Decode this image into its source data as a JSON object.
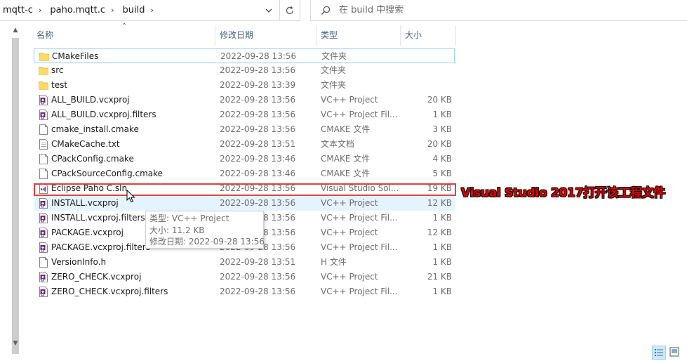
{
  "address": {
    "crumbs": [
      "mqtt-c",
      "paho.mqtt.c",
      "build"
    ],
    "separator": "›"
  },
  "search": {
    "placeholder": "在 build 中搜索"
  },
  "columns": {
    "name": "名称",
    "date": "修改日期",
    "type": "类型",
    "size": "大小"
  },
  "files": [
    {
      "name": "CMakeFiles",
      "date": "2022-09-28 13:56",
      "type": "文件夹",
      "size": "",
      "icon": "folder-icon"
    },
    {
      "name": "src",
      "date": "2022-09-28 13:56",
      "type": "文件夹",
      "size": "",
      "icon": "folder-icon"
    },
    {
      "name": "test",
      "date": "2022-09-28 13:39",
      "type": "文件夹",
      "size": "",
      "icon": "folder-icon"
    },
    {
      "name": "ALL_BUILD.vcxproj",
      "date": "2022-09-28 13:56",
      "type": "VC++ Project",
      "size": "20 KB",
      "icon": "vcxproj-icon"
    },
    {
      "name": "ALL_BUILD.vcxproj.filters",
      "date": "2022-09-28 13:56",
      "type": "VC++ Project Fil...",
      "size": "1 KB",
      "icon": "vcxproj-icon"
    },
    {
      "name": "cmake_install.cmake",
      "date": "2022-09-28 13:56",
      "type": "CMAKE 文件",
      "size": "3 KB",
      "icon": "document-icon"
    },
    {
      "name": "CMakeCache.txt",
      "date": "2022-09-28 13:51",
      "type": "文本文档",
      "size": "20 KB",
      "icon": "text-file-icon"
    },
    {
      "name": "CPackConfig.cmake",
      "date": "2022-09-28 13:46",
      "type": "CMAKE 文件",
      "size": "4 KB",
      "icon": "document-icon"
    },
    {
      "name": "CPackSourceConfig.cmake",
      "date": "2022-09-28 13:46",
      "type": "CMAKE 文件",
      "size": "5 KB",
      "icon": "document-icon"
    },
    {
      "name": "Eclipse Paho C.sln",
      "date": "2022-09-28 13:56",
      "type": "Visual Studio Sol...",
      "size": "19 KB",
      "icon": "visual-studio-solution-icon"
    },
    {
      "name": "INSTALL.vcxproj",
      "date": "2022-09-28 13:56",
      "type": "VC++ Project",
      "size": "12 KB",
      "icon": "vcxproj-icon"
    },
    {
      "name": "INSTALL.vcxproj.filters",
      "date": "2022-09-28 13:56",
      "type": "VC++ Project Fil...",
      "size": "1 KB",
      "icon": "vcxproj-icon"
    },
    {
      "name": "PACKAGE.vcxproj",
      "date": "2022-09-28 13:56",
      "type": "VC++ Project",
      "size": "12 KB",
      "icon": "vcxproj-icon"
    },
    {
      "name": "PACKAGE.vcxproj.filters",
      "date": "2022-09-28 13:56",
      "type": "VC++ Project Fil...",
      "size": "1 KB",
      "icon": "vcxproj-icon"
    },
    {
      "name": "VersionInfo.h",
      "date": "2022-09-28 13:51",
      "type": "H 文件",
      "size": "1 KB",
      "icon": "document-icon"
    },
    {
      "name": "ZERO_CHECK.vcxproj",
      "date": "2022-09-28 13:56",
      "type": "VC++ Project",
      "size": "21 KB",
      "icon": "vcxproj-icon"
    },
    {
      "name": "ZERO_CHECK.vcxproj.filters",
      "date": "2022-09-28 13:56",
      "type": "VC++ Project Fil...",
      "size": "1 KB",
      "icon": "vcxproj-icon"
    }
  ],
  "focused_row": 0,
  "hover_row": 10,
  "annotation": {
    "text": "Visual Studio 2017打开该工程文件",
    "color": "#e00000"
  },
  "tooltip": {
    "type_line": "类型: VC++ Project",
    "size_line": "大小: 11.2 KB",
    "date_line": "修改日期: 2022-09-28 13:56"
  },
  "colors": {
    "header_text": "#4c607a",
    "hover": "#e5f3ff",
    "focus_border": "#99d1ff",
    "folder": "#f8d775"
  }
}
